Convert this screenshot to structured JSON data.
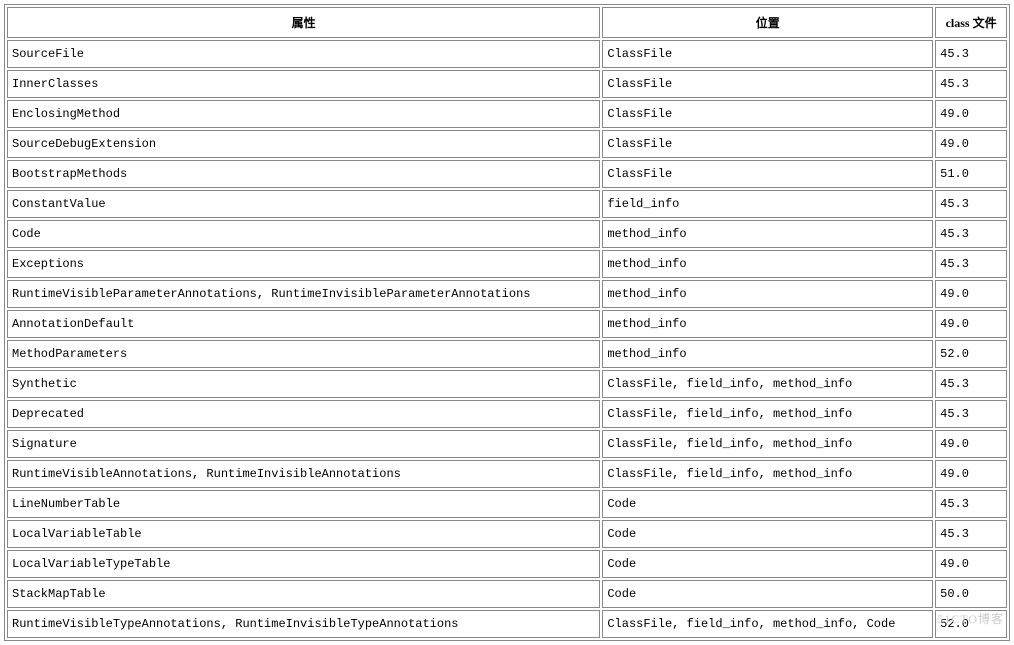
{
  "headers": {
    "attribute": "属性",
    "location": "位置",
    "classfile": "class 文件"
  },
  "rows": [
    {
      "attr": "SourceFile",
      "loc": "ClassFile",
      "ver": "45.3"
    },
    {
      "attr": "InnerClasses",
      "loc": "ClassFile",
      "ver": "45.3"
    },
    {
      "attr": "EnclosingMethod",
      "loc": "ClassFile",
      "ver": "49.0"
    },
    {
      "attr": "SourceDebugExtension",
      "loc": "ClassFile",
      "ver": "49.0"
    },
    {
      "attr": "BootstrapMethods",
      "loc": "ClassFile",
      "ver": "51.0"
    },
    {
      "attr": "ConstantValue",
      "loc": "field_info",
      "ver": "45.3"
    },
    {
      "attr": "Code",
      "loc": "method_info",
      "ver": "45.3"
    },
    {
      "attr": "Exceptions",
      "loc": "method_info",
      "ver": "45.3"
    },
    {
      "attr": "RuntimeVisibleParameterAnnotations, RuntimeInvisibleParameterAnnotations",
      "loc": "method_info",
      "ver": "49.0"
    },
    {
      "attr": "AnnotationDefault",
      "loc": "method_info",
      "ver": "49.0"
    },
    {
      "attr": "MethodParameters",
      "loc": "method_info",
      "ver": "52.0"
    },
    {
      "attr": "Synthetic",
      "loc": "ClassFile, field_info, method_info",
      "ver": "45.3"
    },
    {
      "attr": "Deprecated",
      "loc": "ClassFile, field_info, method_info",
      "ver": "45.3"
    },
    {
      "attr": "Signature",
      "loc": "ClassFile, field_info, method_info",
      "ver": "49.0"
    },
    {
      "attr": "RuntimeVisibleAnnotations, RuntimeInvisibleAnnotations",
      "loc": "ClassFile, field_info, method_info",
      "ver": "49.0"
    },
    {
      "attr": "LineNumberTable",
      "loc": "Code",
      "ver": "45.3"
    },
    {
      "attr": "LocalVariableTable",
      "loc": "Code",
      "ver": "45.3"
    },
    {
      "attr": "LocalVariableTypeTable",
      "loc": "Code",
      "ver": "49.0"
    },
    {
      "attr": "StackMapTable",
      "loc": "Code",
      "ver": "50.0"
    },
    {
      "attr": "RuntimeVisibleTypeAnnotations, RuntimeInvisibleTypeAnnotations",
      "loc": "ClassFile, field_info, method_info, Code",
      "ver": "52.0"
    }
  ],
  "watermark": "51CTO博客"
}
